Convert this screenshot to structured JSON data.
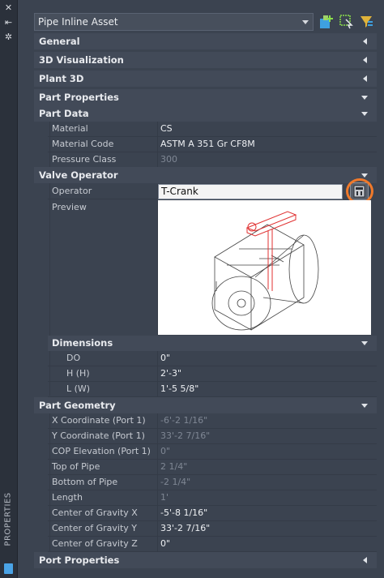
{
  "strip": {
    "title": "PROPERTIES"
  },
  "header": {
    "selected_type": "Pipe Inline Asset"
  },
  "sections": {
    "general": "General",
    "visualization_3d": "3D Visualization",
    "plant_3d": "Plant 3D",
    "part_properties": "Part Properties",
    "part_data": "Part Data",
    "valve_operator": "Valve Operator",
    "dimensions": "Dimensions",
    "part_geometry": "Part Geometry",
    "port_properties": "Port Properties"
  },
  "part_data": [
    {
      "label": "Material",
      "value": "CS"
    },
    {
      "label": "Material Code",
      "value": "ASTM A 351 Gr CF8M"
    },
    {
      "label": "Pressure Class",
      "value": "300"
    }
  ],
  "valve_operator": {
    "operator_label": "Operator",
    "operator_value": "T-Crank",
    "preview_label": "Preview"
  },
  "dimensions": [
    {
      "label": "DO",
      "value": "0\""
    },
    {
      "label": "H (H)",
      "value": "2'-3\""
    },
    {
      "label": "L (W)",
      "value": "1'-5 5/8\""
    }
  ],
  "part_geometry": [
    {
      "label": "X Coordinate (Port 1)",
      "value": "-6'-2 1/16\""
    },
    {
      "label": "Y Coordinate (Port 1)",
      "value": "33'-2 7/16\""
    },
    {
      "label": "COP Elevation (Port 1)",
      "value": "0\""
    },
    {
      "label": "Top of Pipe",
      "value": "2 1/4\""
    },
    {
      "label": "Bottom of Pipe",
      "value": "-2 1/4\""
    },
    {
      "label": "Length",
      "value": "1'"
    },
    {
      "label": "Center of Gravity X",
      "value": "-5'-8 1/16\""
    },
    {
      "label": "Center of Gravity Y",
      "value": "33'-2 7/16\""
    },
    {
      "label": "Center of Gravity Z",
      "value": "0\""
    }
  ],
  "colors": {
    "panel_bg": "#3b4350",
    "highlight_ring": "#f0792a",
    "accent_blue": "#4aa3e6"
  }
}
